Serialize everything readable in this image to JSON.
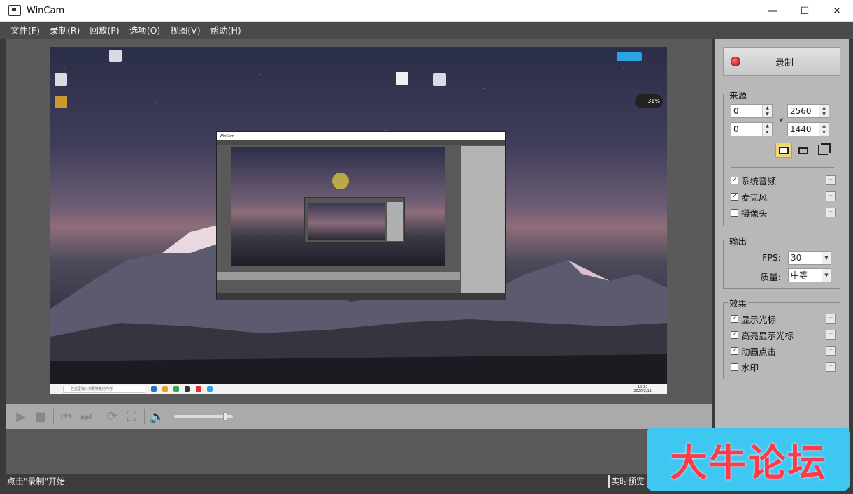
{
  "window": {
    "title": "WinCam",
    "minimize": "—",
    "maximize": "☐",
    "close": "✕"
  },
  "menu": [
    "文件(F)",
    "录制(R)",
    "回放(P)",
    "选项(O)",
    "视图(V)",
    "帮助(H)"
  ],
  "preview": {
    "desktop_badge": "31%",
    "search_placeholder": "在这里输入你要搜索的内容",
    "clock_time": "10:23",
    "clock_date": "2020/2/11",
    "nested_title": "WinCam"
  },
  "controls": {
    "play_icon": "▶",
    "stop_icon": "■",
    "prev_icon": "⏮",
    "next_icon": "⏭",
    "loop_icon": "⟳",
    "fullscreen_icon": "⛶",
    "volume_icon": "🔈",
    "volume_level": 0.9
  },
  "panel": {
    "record_label": "录制",
    "source": {
      "title": "来源",
      "x": "0",
      "y": "0",
      "width": "2560",
      "height": "1440",
      "separator": "x"
    },
    "audio": [
      {
        "label": "系统音频",
        "checked": true
      },
      {
        "label": "麦克风",
        "checked": true
      },
      {
        "label": "摄像头",
        "checked": false
      }
    ],
    "output": {
      "title": "输出",
      "fps_label": "FPS:",
      "fps_value": "30",
      "quality_label": "质量:",
      "quality_value": "中等"
    },
    "effects": {
      "title": "效果",
      "items": [
        {
          "label": "显示光标",
          "checked": true
        },
        {
          "label": "高亮显示光标",
          "checked": true
        },
        {
          "label": "动画点击",
          "checked": true
        },
        {
          "label": "水印",
          "checked": false
        }
      ]
    }
  },
  "status": {
    "left": "点击\"录制\"开始",
    "right": "实时预览"
  },
  "watermark": "大牛论坛",
  "check_mark": "✓",
  "dots": "...",
  "spin_up": "▲",
  "spin_down": "▼",
  "dropdown": "▼"
}
